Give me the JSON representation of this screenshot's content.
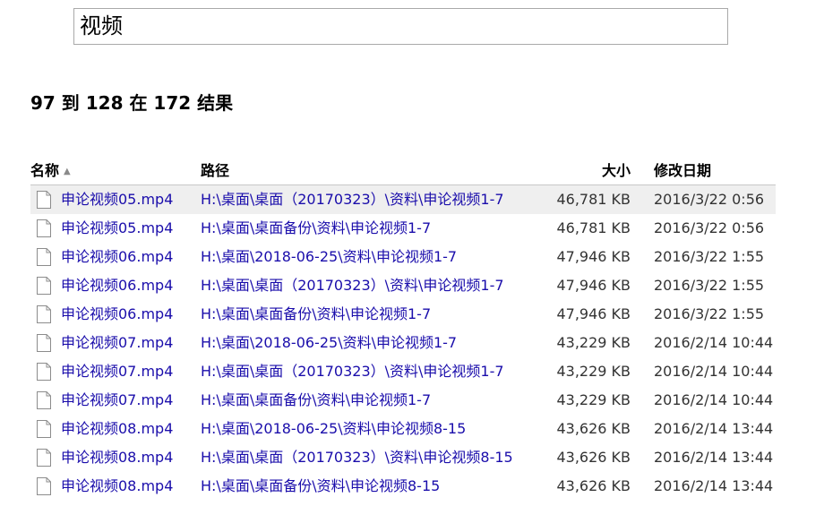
{
  "search": {
    "value": "视频"
  },
  "summary": "97 到 128 在 172 结果",
  "columns": {
    "name": "名称",
    "path": "路径",
    "size": "大小",
    "date": "修改日期"
  },
  "rows": [
    {
      "name": "申论视频05.mp4",
      "path": "H:\\桌面\\桌面（20170323）\\资料\\申论视频1-7",
      "size": "46,781 KB",
      "date": "2016/3/22 0:56"
    },
    {
      "name": "申论视频05.mp4",
      "path": "H:\\桌面\\桌面备份\\资料\\申论视频1-7",
      "size": "46,781 KB",
      "date": "2016/3/22 0:56"
    },
    {
      "name": "申论视频06.mp4",
      "path": "H:\\桌面\\2018-06-25\\资料\\申论视频1-7",
      "size": "47,946 KB",
      "date": "2016/3/22 1:55"
    },
    {
      "name": "申论视频06.mp4",
      "path": "H:\\桌面\\桌面（20170323）\\资料\\申论视频1-7",
      "size": "47,946 KB",
      "date": "2016/3/22 1:55"
    },
    {
      "name": "申论视频06.mp4",
      "path": "H:\\桌面\\桌面备份\\资料\\申论视频1-7",
      "size": "47,946 KB",
      "date": "2016/3/22 1:55"
    },
    {
      "name": "申论视频07.mp4",
      "path": "H:\\桌面\\2018-06-25\\资料\\申论视频1-7",
      "size": "43,229 KB",
      "date": "2016/2/14 10:44"
    },
    {
      "name": "申论视频07.mp4",
      "path": "H:\\桌面\\桌面（20170323）\\资料\\申论视频1-7",
      "size": "43,229 KB",
      "date": "2016/2/14 10:44"
    },
    {
      "name": "申论视频07.mp4",
      "path": "H:\\桌面\\桌面备份\\资料\\申论视频1-7",
      "size": "43,229 KB",
      "date": "2016/2/14 10:44"
    },
    {
      "name": "申论视频08.mp4",
      "path": "H:\\桌面\\2018-06-25\\资料\\申论视频8-15",
      "size": "43,626 KB",
      "date": "2016/2/14 13:44"
    },
    {
      "name": "申论视频08.mp4",
      "path": "H:\\桌面\\桌面（20170323）\\资料\\申论视频8-15",
      "size": "43,626 KB",
      "date": "2016/2/14 13:44"
    },
    {
      "name": "申论视频08.mp4",
      "path": "H:\\桌面\\桌面备份\\资料\\申论视频8-15",
      "size": "43,626 KB",
      "date": "2016/2/14 13:44"
    }
  ]
}
